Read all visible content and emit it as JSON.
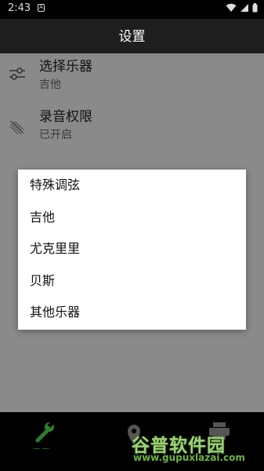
{
  "status_bar": {
    "time": "2:43",
    "notification_glyph": "A"
  },
  "app_bar": {
    "title": "设置"
  },
  "preferences": [
    {
      "title": "选择乐器",
      "summary": "吉他",
      "icon": "tune-sliders-icon"
    },
    {
      "title": "录音权限",
      "summary": "已开启",
      "icon": "mic-permission-icon"
    }
  ],
  "dialog": {
    "options": [
      "特殊调弦",
      "吉他",
      "尤克里里",
      "贝斯",
      "其他乐器"
    ]
  },
  "bottom_nav": {
    "items": [
      {
        "icon": "wrench-icon",
        "label": "一 一"
      },
      {
        "icon": "map-pin-icon"
      },
      {
        "icon": "printer-icon"
      }
    ]
  },
  "watermark": {
    "title": "谷普软件园",
    "url": "www.gupuxlazai.com"
  },
  "colors": {
    "accent": "#2e7d2e",
    "dim_background": "#8a8a8a",
    "dialog_background": "#ffffff",
    "app_bar": "#1e1e1e"
  }
}
